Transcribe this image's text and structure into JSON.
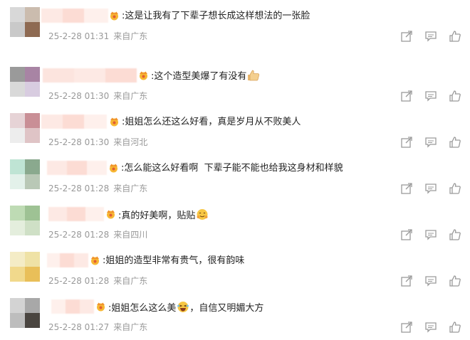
{
  "comments": [
    {
      "text": ":这是让我有了下辈子想长成这样想法的一张脸",
      "time": "25-2-28 01:31",
      "location": "来自广东",
      "emoji": null
    },
    {
      "text": ":这个造型美爆了有没有",
      "time": "25-2-28 01:30",
      "location": "来自广东",
      "emoji": "thumbs-up"
    },
    {
      "text": ":姐姐怎么还这么好看，真是岁月从不败美人",
      "time": "25-2-28 01:30",
      "location": "来自河北",
      "emoji": null
    },
    {
      "text": ":怎么能这么好看啊  下辈子能不能也给我这身材和样貌",
      "time": "25-2-28 01:28",
      "location": "来自广东",
      "emoji": null
    },
    {
      "text": ":真的好美啊，贴贴",
      "time": "25-2-28 01:28",
      "location": "来自四川",
      "emoji": "hugging-face"
    },
    {
      "text": ":姐姐的造型非常有贵气，很有韵味",
      "time": "25-2-28 01:28",
      "location": "来自广东",
      "emoji": null
    },
    {
      "text": ":姐姐怎么这么美",
      "text2": "，自信又明媚大方",
      "time": "25-2-28 01:27",
      "location": "来自广东",
      "emoji": "laughing-face"
    }
  ],
  "icons": {
    "share": "share-icon",
    "comment": "comment-icon",
    "like": "like-icon",
    "badge": "crown-badge-icon"
  },
  "colors": {
    "meta": "#999999",
    "text": "#222222",
    "icon": "#9a9a9a",
    "badge": "#f5a623"
  }
}
